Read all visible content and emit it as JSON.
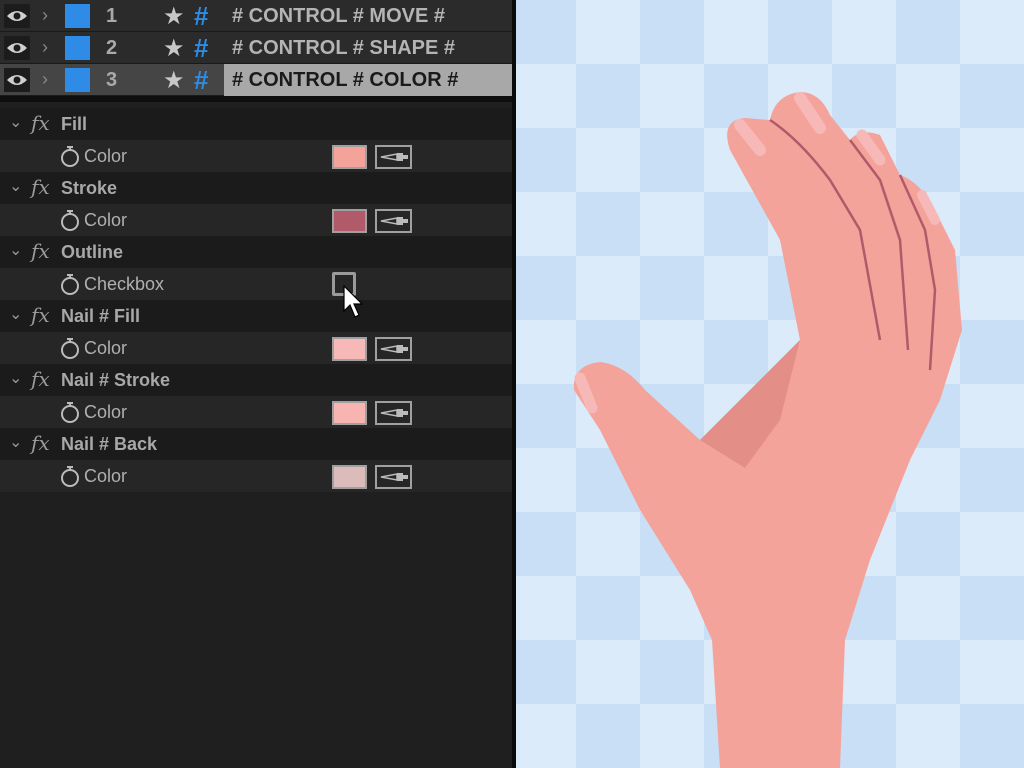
{
  "layers": [
    {
      "number": "1",
      "name": "# CONTROL # MOVE #",
      "label_color": "#2e8be6",
      "selected": false
    },
    {
      "number": "2",
      "name": "# CONTROL # SHAPE #",
      "label_color": "#2e8be6",
      "selected": false
    },
    {
      "number": "3",
      "name": "# CONTROL # COLOR #",
      "label_color": "#2e8be6",
      "selected": true
    }
  ],
  "effects": [
    {
      "title": "Fill",
      "property": "Color",
      "type": "color",
      "value": "#f4a39b"
    },
    {
      "title": "Stroke",
      "property": "Color",
      "type": "color",
      "value": "#b05a6a"
    },
    {
      "title": "Outline",
      "property": "Checkbox",
      "type": "checkbox",
      "value": false
    },
    {
      "title": "Nail # Fill",
      "property": "Color",
      "type": "color",
      "value": "#f7b9b7"
    },
    {
      "title": "Nail # Stroke",
      "property": "Color",
      "type": "color",
      "value": "#f7b4b0"
    },
    {
      "title": "Nail # Back",
      "property": "Color",
      "type": "color",
      "value": "#dcbcbb"
    }
  ],
  "icons": {
    "visibility": "eye-icon",
    "expand": "chevron-right-icon",
    "collapse": "chevron-down-icon",
    "favorite": "star-icon",
    "control": "hash-icon",
    "effect": "fx-icon",
    "stopwatch": "stopwatch-icon",
    "eyedropper": "eyedropper-icon",
    "cursor": "arrow-cursor-icon"
  },
  "preview": {
    "checker_colors": [
      "#c8dff6",
      "#dcebfa"
    ],
    "skin_color": "#f4a39b",
    "crease_color": "#b05a6a"
  }
}
